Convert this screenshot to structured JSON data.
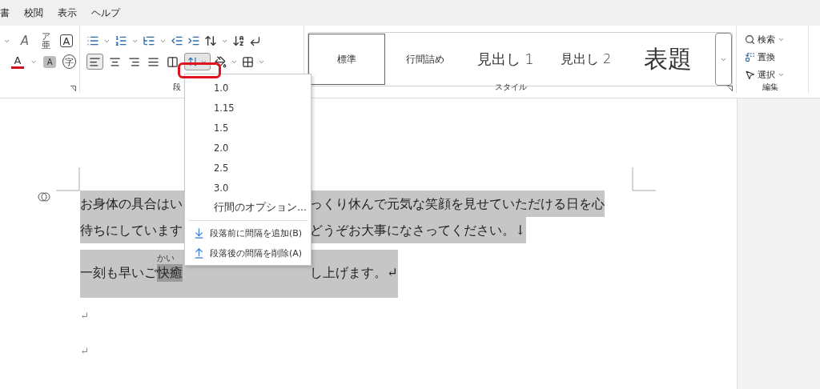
{
  "menu_tabs": [
    {
      "label": "書"
    },
    {
      "label": "校閲"
    },
    {
      "label": "表示"
    },
    {
      "label": "ヘルプ"
    }
  ],
  "font_group": {
    "row1": [
      {
        "kind": "chevron"
      },
      {
        "kind": "clear",
        "label": "A"
      },
      {
        "kind": "ruby",
        "label": "ア",
        "sub": "亜"
      },
      {
        "kind": "boxed",
        "label": "A"
      }
    ],
    "row2": [
      {
        "kind": "color",
        "label": "A"
      },
      {
        "kind": "chevron"
      },
      {
        "kind": "shade",
        "label": "A"
      },
      {
        "kind": "circled",
        "label": "字"
      }
    ]
  },
  "paragraph_group": {
    "label": "段",
    "alignment": [
      {
        "kind": "left",
        "selected": true
      },
      {
        "kind": "center",
        "selected": false
      },
      {
        "kind": "right",
        "selected": false
      },
      {
        "kind": "justify",
        "selected": false
      },
      {
        "kind": "distribute",
        "selected": false
      }
    ],
    "line_spacing_open": true
  },
  "styles_group": {
    "label": "スタイル",
    "styles": [
      {
        "label": "標準",
        "kind": "body",
        "selected": true
      },
      {
        "label": "行間詰め",
        "kind": "compact",
        "selected": false
      },
      {
        "label": "見出し 1",
        "kind": "heading1",
        "selected": false
      },
      {
        "label": "見出し 2",
        "kind": "heading2",
        "selected": false
      },
      {
        "label": "表題",
        "kind": "title",
        "selected": false
      }
    ]
  },
  "editing_group": {
    "label": "編集",
    "items": [
      {
        "label": "検索",
        "kind": "search"
      },
      {
        "label": "置換",
        "kind": "replace"
      },
      {
        "label": "選択",
        "kind": "select"
      }
    ]
  },
  "line_spacing_menu": [
    {
      "label": "1.0",
      "kind": "value"
    },
    {
      "label": "1.15",
      "kind": "value"
    },
    {
      "label": "1.5",
      "kind": "value"
    },
    {
      "label": "2.0",
      "kind": "value"
    },
    {
      "label": "2.5",
      "kind": "value"
    },
    {
      "label": "3.0",
      "kind": "value"
    },
    {
      "label": "行間のオプション...",
      "kind": "option"
    },
    {
      "label": "段落前に間隔を追加(B)",
      "kind": "add-before"
    },
    {
      "label": "段落後の間隔を削除(A)",
      "kind": "remove-after"
    }
  ],
  "document": {
    "lines": [
      {
        "left": "お身体の具合はい",
        "right": "っくり休んで元気な笑顔を見せていただける日を心",
        "selected": true
      },
      {
        "left": "待ちにしています",
        "right": "どうぞお大事になさってください。↓",
        "selected": true
      },
      {
        "left": "一刻も早いご",
        "marked": "快癒",
        "ruby": "かい",
        "right": "し上げます。↵",
        "selected": true
      }
    ],
    "empty_paragraphs": [
      "↵",
      "↵"
    ]
  }
}
